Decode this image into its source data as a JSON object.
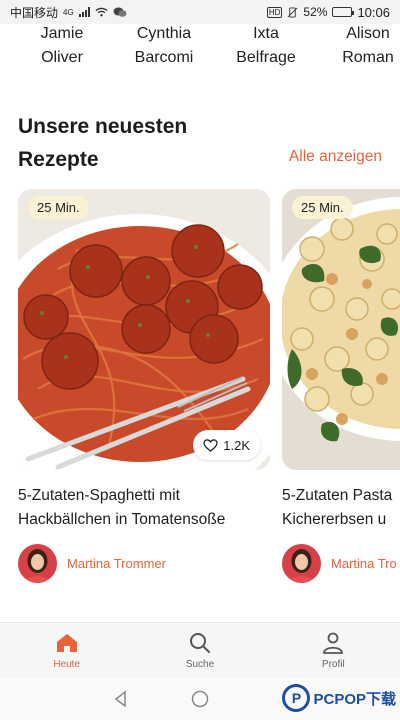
{
  "status_bar": {
    "carrier": "中国移动",
    "network": "4G",
    "hd": "HD",
    "battery": "52%",
    "battery_level": 0.52,
    "time": "10:06"
  },
  "authors": [
    {
      "first": "Jamie",
      "last": "Oliver"
    },
    {
      "first": "Cynthia",
      "last": "Barcomi"
    },
    {
      "first": "Ixta",
      "last": "Belfrage"
    },
    {
      "first": "Alison",
      "last": "Roman"
    }
  ],
  "section": {
    "title": "Unsere neuesten Rezepte",
    "see_all": "Alle anzeigen"
  },
  "recipes": [
    {
      "time": "25 Min.",
      "likes": "1.2K",
      "title_line1": "5-Zutaten-Spaghetti mit",
      "title_line2": "Hackbällchen in Tomatensoße",
      "author": "Martina Trommer"
    },
    {
      "time": "25 Min.",
      "title_line1": "5-Zutaten Pasta",
      "title_line2": "Kichererbsen u",
      "author": "Martina Tro"
    }
  ],
  "bottom_nav": [
    {
      "label": "Heute",
      "icon": "home-icon",
      "active": true
    },
    {
      "label": "Suche",
      "icon": "search-icon",
      "active": false
    },
    {
      "label": "Profil",
      "icon": "profile-icon",
      "active": false
    }
  ],
  "watermark": {
    "text": "PCPOP下载",
    "mark": "P"
  },
  "colors": {
    "accent": "#e8633a",
    "badge_bg": "#fbf2d4",
    "nav_bg": "#f6f6f6"
  }
}
